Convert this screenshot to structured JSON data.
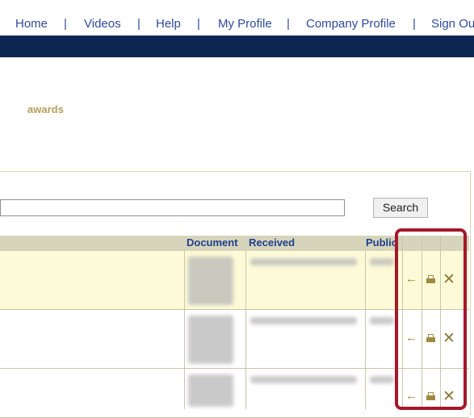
{
  "nav": {
    "home": "Home",
    "videos": "Videos",
    "help": "Help",
    "my_profile": "My Profile",
    "company_profile": "Company Profile",
    "sign_out": "Sign Out",
    "separator": "|"
  },
  "section": {
    "awards": "awards"
  },
  "search": {
    "button": "Search",
    "input_value": ""
  },
  "table": {
    "headers": {
      "document": "Document",
      "received": "Received",
      "public": "Public"
    },
    "rows": [
      {
        "actions": [
          "arrow-left-icon",
          "print-icon",
          "delete-icon"
        ]
      },
      {
        "actions": [
          "arrow-left-icon",
          "print-icon",
          "delete-icon"
        ]
      },
      {
        "actions": [
          "arrow-left-icon",
          "print-icon",
          "delete-icon"
        ]
      }
    ]
  },
  "colors": {
    "navbar": "#0d2754",
    "link": "#2f4b97",
    "accent": "#b59f5a",
    "highlight": "#a4182a",
    "row_highlight": "#fdfbd7"
  },
  "icons": {
    "arrow": "←",
    "delete": "✕"
  }
}
